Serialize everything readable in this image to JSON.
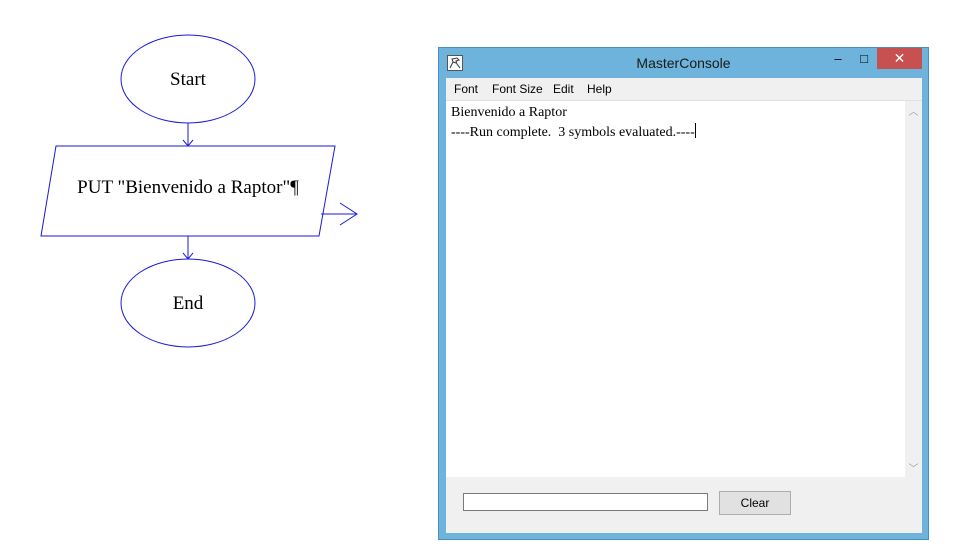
{
  "flowchart": {
    "start_label": "Start",
    "output_label": "PUT \"Bienvenido a Raptor\"¶",
    "end_label": "End"
  },
  "console": {
    "title": "MasterConsole",
    "minimize_glyph": "–",
    "maximize_glyph": "□",
    "close_glyph": "✕",
    "menu": [
      "Font",
      "Font Size",
      "Edit",
      "Help"
    ],
    "output_lines": [
      "Bienvenido a Raptor",
      "----Run complete.  3 symbols evaluated.----"
    ],
    "input_value": "",
    "clear_label": "Clear",
    "scroll_up_glyph": "︿",
    "scroll_down_glyph": "﹀"
  },
  "colors": {
    "flow_stroke": "#1a1ad9",
    "title_bar": "#6db3dc",
    "close_button": "#c75050"
  },
  "icons": [
    "raptor-app-icon",
    "minimize-icon",
    "maximize-icon",
    "close-icon",
    "scroll-up-icon",
    "scroll-down-icon"
  ]
}
